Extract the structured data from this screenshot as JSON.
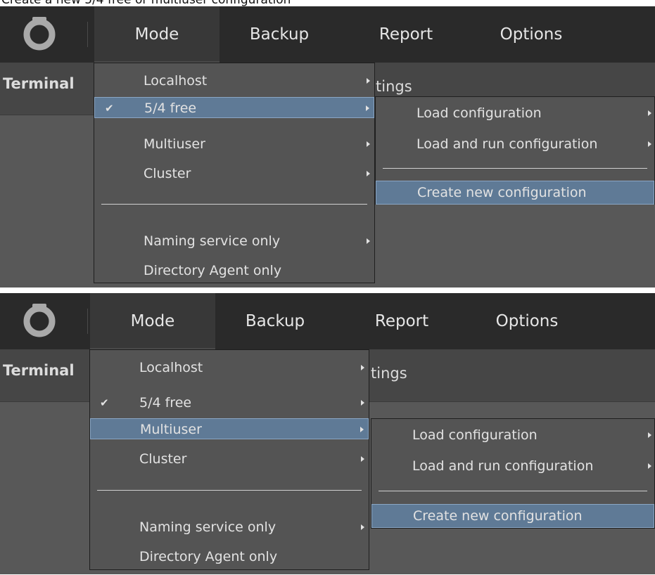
{
  "caption": "Create a new 5/4 free or multiuser configuration",
  "menubar": {
    "items": [
      "Mode",
      "Backup",
      "Report",
      "Options"
    ]
  },
  "subbar": {
    "terminal_label": "Terminal",
    "settings_fragment": "tings"
  },
  "mode_menu": {
    "items": [
      {
        "label": "Localhost",
        "has_submenu": true
      },
      {
        "label": "5/4 free",
        "has_submenu": true,
        "checked": true
      },
      {
        "label": "Multiuser",
        "has_submenu": true
      },
      {
        "label": "Cluster",
        "has_submenu": true
      },
      {
        "label": "Naming service only",
        "has_submenu": true
      },
      {
        "label": "Directory Agent only",
        "has_submenu": false
      }
    ],
    "check_glyph": "✔"
  },
  "config_submenu": {
    "items": [
      {
        "label": "Load configuration",
        "has_submenu": true
      },
      {
        "label": "Load and run configuration",
        "has_submenu": true
      },
      {
        "label": "Create new configuration",
        "has_submenu": false
      }
    ]
  },
  "panels": [
    {
      "highlighted_mode_item": "5/4 free",
      "highlighted_submenu_item": "Create new configuration"
    },
    {
      "highlighted_mode_item": "Multiuser",
      "highlighted_submenu_item": "Create new configuration"
    }
  ],
  "colors": {
    "topbar": "#2a2a2a",
    "highlight": "#5f7a96",
    "highlight_border": "#8aa6c4",
    "menu_bg": "#545454"
  },
  "icons": {
    "logo": "ring-logo-icon",
    "checkmark": "checkmark-icon",
    "submenu_arrow": "chevron-right-icon"
  }
}
